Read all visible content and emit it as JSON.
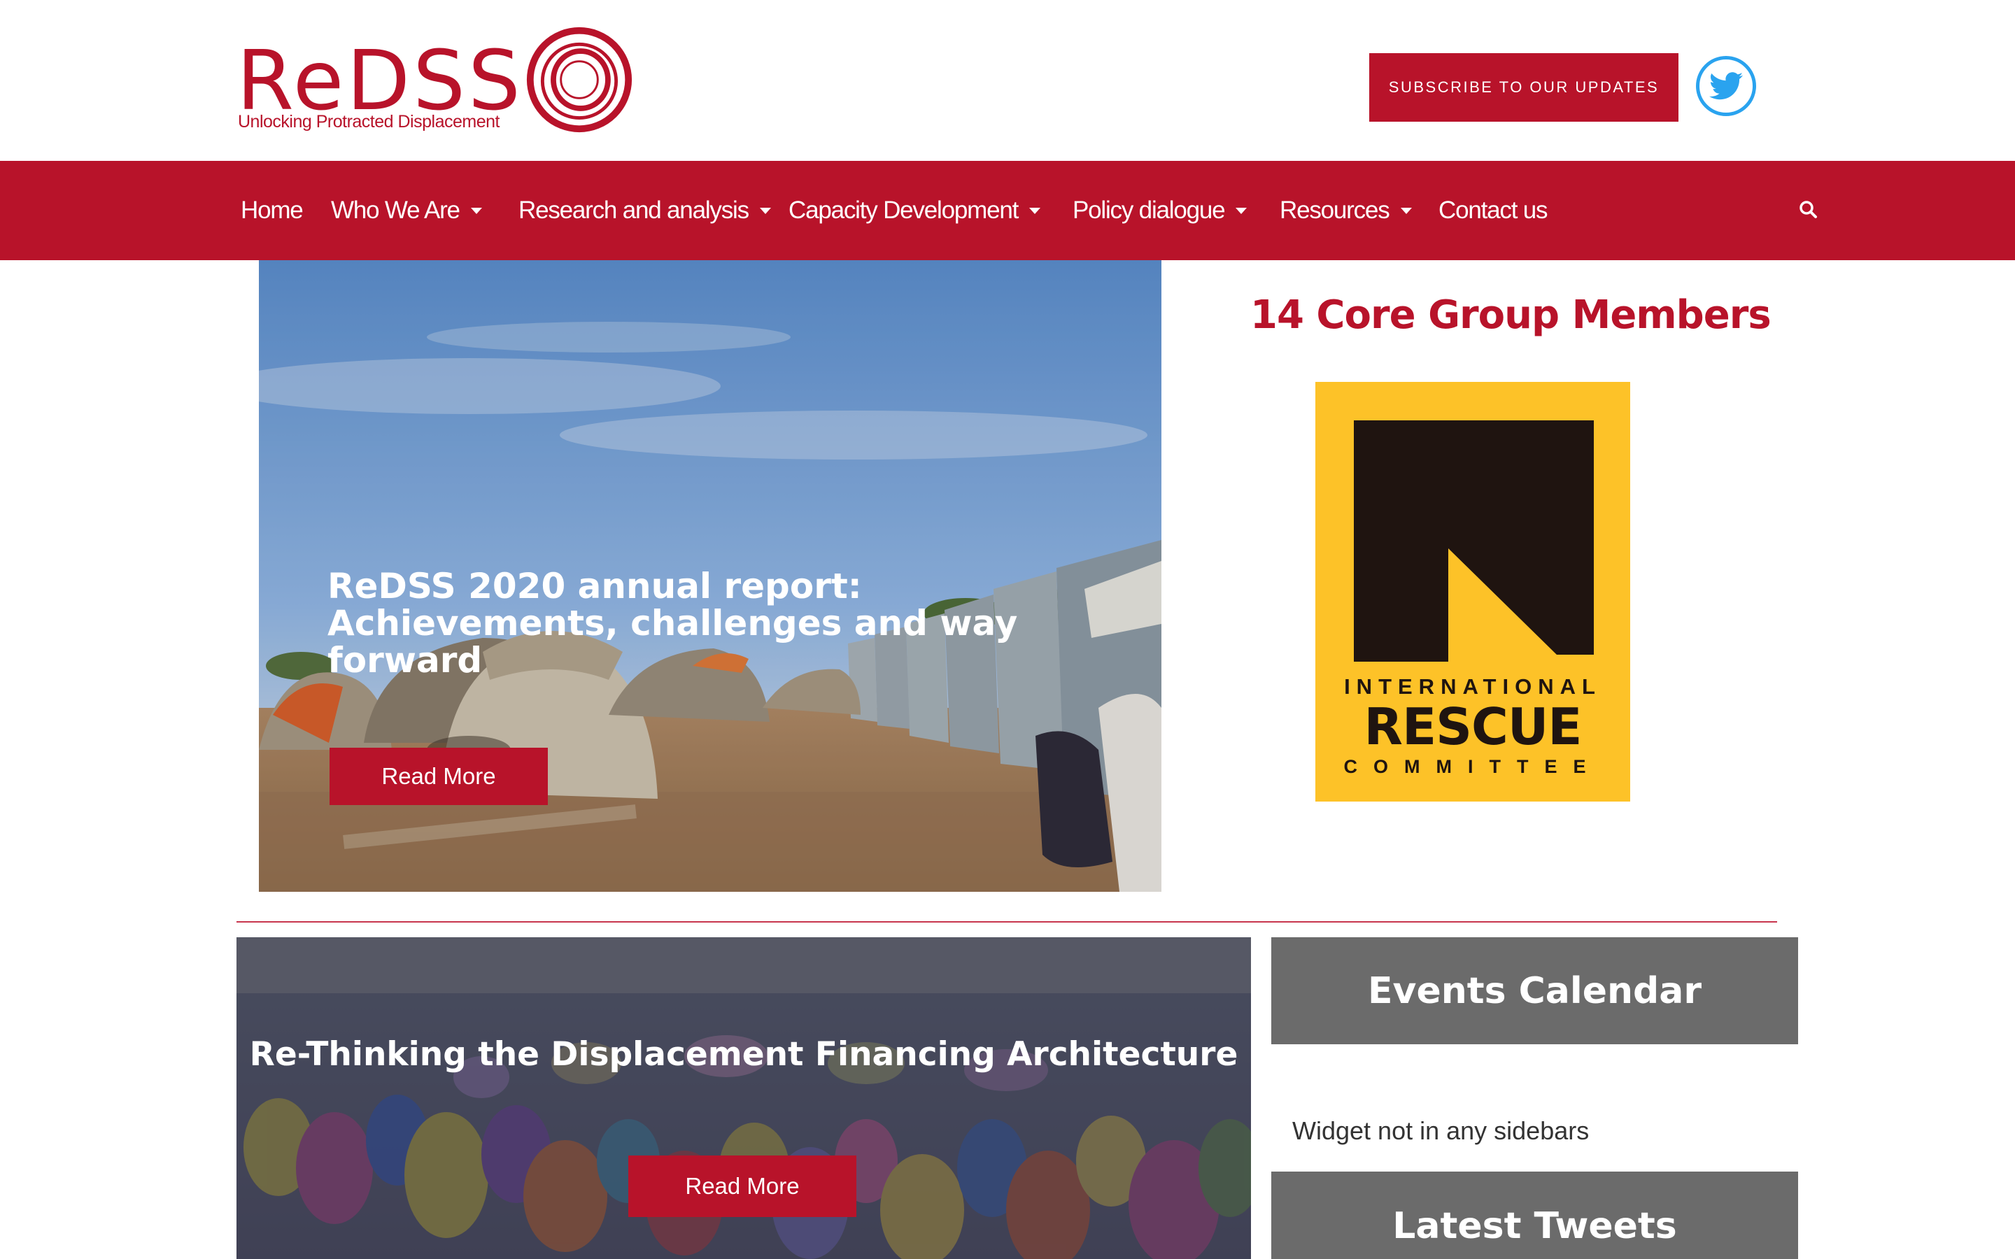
{
  "brand": {
    "name": "ReDSS",
    "tagline": "Unlocking Protracted Displacement",
    "color": "#b8132a"
  },
  "header": {
    "subscribe_label": "SUBSCRIBE TO OUR UPDATES",
    "social_icon": "twitter-icon"
  },
  "nav": {
    "items": [
      {
        "label": "Home",
        "has_dropdown": false
      },
      {
        "label": "Who We Are",
        "has_dropdown": true
      },
      {
        "label": "Research and analysis",
        "has_dropdown": true
      },
      {
        "label": "Capacity Development",
        "has_dropdown": true
      },
      {
        "label": "Policy dialogue",
        "has_dropdown": true
      },
      {
        "label": "Resources",
        "has_dropdown": true
      },
      {
        "label": "Contact us",
        "has_dropdown": false
      }
    ],
    "search_icon": "search-icon"
  },
  "featured": {
    "title": "ReDSS 2020 annual report: Achievements, challenges and way forward",
    "button_label": "Read More"
  },
  "core_group": {
    "title": "14 Core Group Members",
    "member_logo": {
      "line1": "INTERNATIONAL",
      "line2": "RESCUE",
      "line3": "COMMITTEE"
    }
  },
  "second_feature": {
    "title": "Re-Thinking the Displacement Financing Architecture",
    "button_label": "Read More"
  },
  "sidebar": {
    "events_title": "Events Calendar",
    "widget_note": "Widget not in any sidebars",
    "tweets_title": "Latest Tweets"
  },
  "colors": {
    "accent": "#b8132a",
    "widget_gray": "#6b6b6b",
    "twitter_blue": "#2aa3ef",
    "irc_yellow": "#fdc228"
  }
}
